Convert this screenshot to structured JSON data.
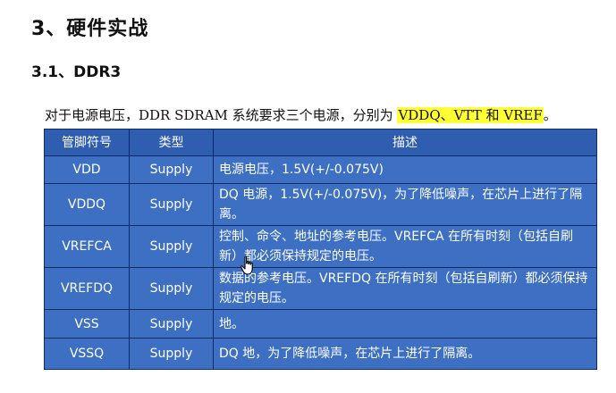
{
  "headings": {
    "section": "3、硬件实战",
    "subsection": "3.1、DDR3"
  },
  "intro": {
    "prefix": "对于电源电压，DDR SDRAM 系统要求三个电源，分别为 ",
    "highlight": "VDDQ、VTT 和 VREF",
    "suffix": "。"
  },
  "table": {
    "headers": [
      "管脚符号",
      "类型",
      "描述"
    ],
    "rows": [
      {
        "pin": "VDD",
        "type": "Supply",
        "desc": "电源电压，1.5V(+/-0.075V)"
      },
      {
        "pin": "VDDQ",
        "type": "Supply",
        "desc": "DQ 电源，1.5V(+/-0.075V)，为了降低噪声，在芯片上进行了隔离。"
      },
      {
        "pin": "VREFCA",
        "type": "Supply",
        "desc": "控制、命令、地址的参考电压。VREFCA 在所有时刻（包括自刷新）都必须保持规定的电压。"
      },
      {
        "pin": "VREFDQ",
        "type": "Supply",
        "desc": "数据的参考电压。VREFDQ 在所有时刻（包括自刷新）都必须保持规定的电压。"
      },
      {
        "pin": "VSS",
        "type": "Supply",
        "desc": "地。"
      },
      {
        "pin": "VSSQ",
        "type": "Supply",
        "desc": "DQ 地，为了降低噪声，在芯片上进行了隔离。"
      }
    ]
  },
  "colors": {
    "header_bg": "#2f5eb0",
    "cell_bg": "#3d6fc2",
    "highlight": "#ffff33"
  },
  "icons": {
    "cursor": "hand-pointer-icon"
  }
}
